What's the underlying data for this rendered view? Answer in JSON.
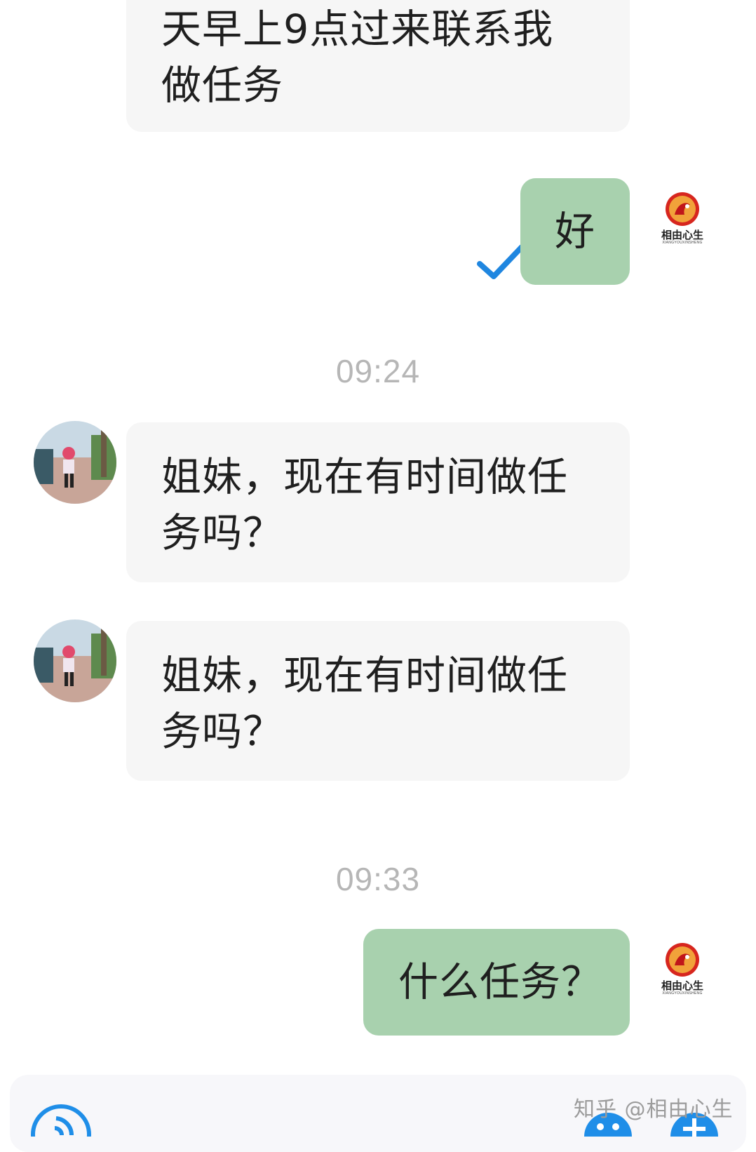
{
  "messages": [
    {
      "direction": "incoming",
      "lines": [
        "天早上9点过来联系我",
        "做任务"
      ]
    },
    {
      "direction": "outgoing",
      "lines": [
        "好"
      ],
      "read_receipt": "check-icon"
    },
    {
      "direction": "incoming",
      "lines": [
        "姐妹，现在有时间做任",
        "务吗？"
      ]
    },
    {
      "direction": "incoming",
      "lines": [
        "姐妹，现在有时间做任",
        "务吗？"
      ]
    },
    {
      "direction": "outgoing",
      "lines": [
        "什么任务？"
      ]
    }
  ],
  "timestamps": [
    "09:24",
    "09:33"
  ],
  "self_avatar": {
    "text": "相由心生",
    "subtext": "XIANGYOUXINSHENG"
  },
  "watermark": "知乎 @相由心生",
  "input_bar": {
    "left_icon": "voice-icon",
    "right_icons": [
      "emoji-icon",
      "plus-icon"
    ]
  },
  "colors": {
    "incoming_bubble": "#f6f6f6",
    "outgoing_bubble": "#a8d1ae",
    "timestamp": "#b6b6b6",
    "check": "#1f86e0",
    "accent_icon": "#1f8ee8"
  }
}
